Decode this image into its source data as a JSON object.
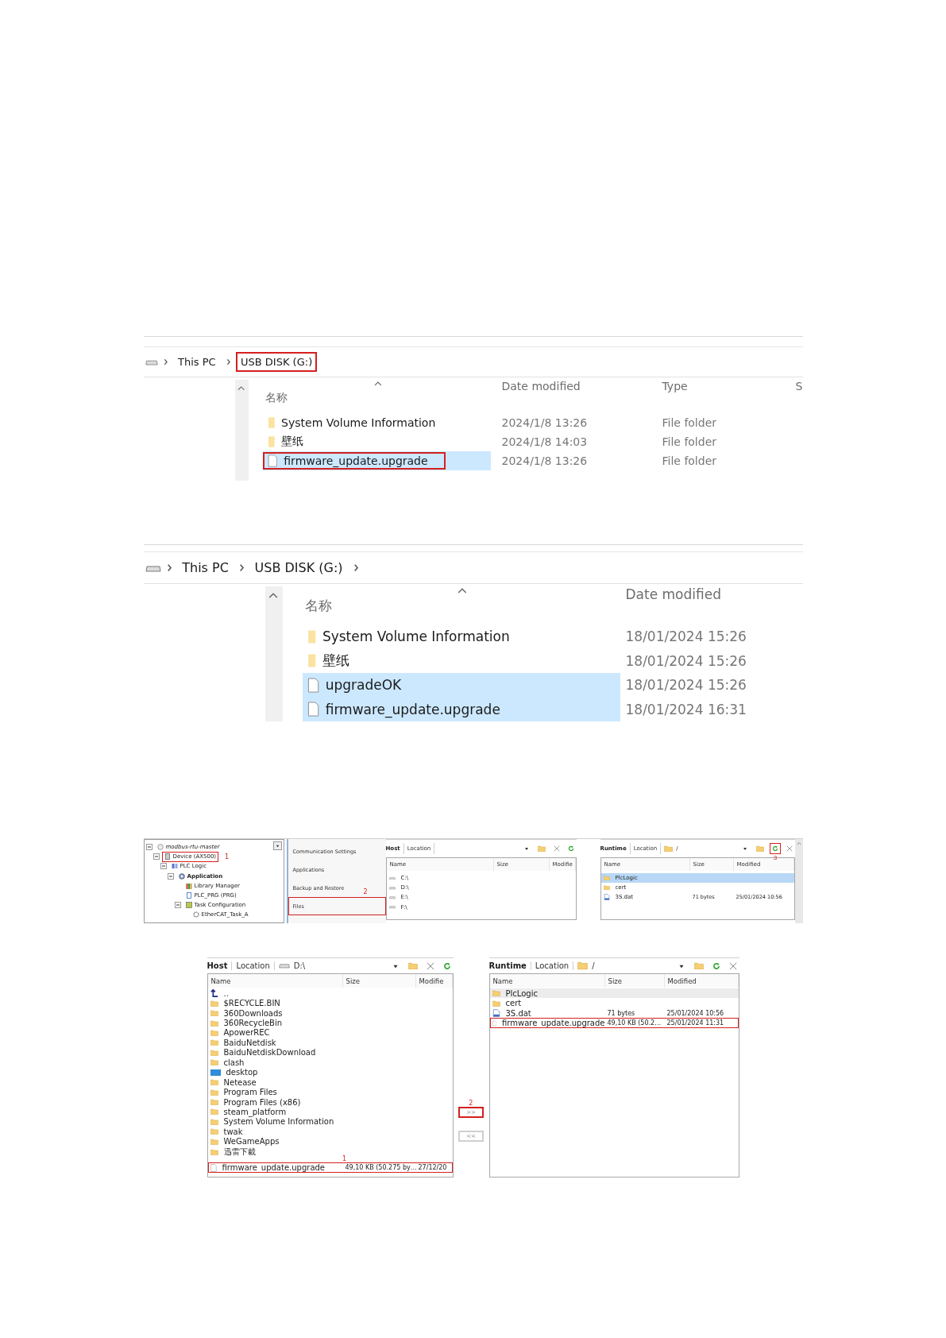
{
  "explorer_views": [
    {
      "kind": "compact",
      "crumbs": [
        {
          "label": "This PC",
          "highlighted": false
        },
        {
          "label": "USB DISK (G:)",
          "highlighted": true
        }
      ],
      "trailing_chevron": false,
      "columns": [
        "名称",
        "Date modified",
        "Type",
        "S"
      ],
      "rows": [
        {
          "kind": "folder",
          "cells": [
            "System Volume Information",
            "2024/1/8 13:26",
            "File folder"
          ],
          "selected": false,
          "highlighted": false
        },
        {
          "kind": "folder",
          "cells": [
            "壁纸",
            "2024/1/8 14:03",
            "File folder"
          ],
          "selected": false,
          "highlighted": false
        },
        {
          "kind": "file",
          "cells": [
            "firmware_update.upgrade",
            "2024/1/8 13:26",
            "File folder"
          ],
          "selected": true,
          "highlighted": true
        }
      ]
    },
    {
      "kind": "large",
      "crumbs": [
        {
          "label": "This PC",
          "highlighted": false
        },
        {
          "label": "USB DISK (G:)",
          "highlighted": false
        }
      ],
      "trailing_chevron": true,
      "columns": [
        "名称",
        "Date modified"
      ],
      "rows": [
        {
          "kind": "folder",
          "cells": [
            "System Volume Information",
            "18/01/2024 15:26"
          ],
          "selected": false,
          "highlighted": false
        },
        {
          "kind": "folder",
          "cells": [
            "壁纸",
            "18/01/2024 15:26"
          ],
          "selected": false,
          "highlighted": false
        },
        {
          "kind": "file",
          "cells": [
            "upgradeOK",
            "18/01/2024 15:26"
          ],
          "selected": true,
          "highlighted": false
        },
        {
          "kind": "file",
          "cells": [
            "firmware_update.upgrade",
            "18/01/2024 16:31"
          ],
          "selected": true,
          "highlighted": false
        }
      ]
    }
  ],
  "device_view": {
    "tree": [
      {
        "kind": "project",
        "label": "modbus-rtu-master",
        "expanded": true,
        "highlighted": false,
        "children": [
          {
            "kind": "device",
            "label": "Device (AX500)",
            "expanded": true,
            "highlighted": true,
            "callout": "1",
            "children": [
              {
                "kind": "plc_logic",
                "label": "PLC Logic",
                "expanded": true,
                "highlighted": false,
                "children": [
                  {
                    "kind": "application",
                    "label": "Application",
                    "expanded": true,
                    "highlighted": false,
                    "children": [
                      {
                        "kind": "library",
                        "label": "Library Manager",
                        "highlighted": false
                      },
                      {
                        "kind": "pou",
                        "label": "PLC_PRG (PRG)",
                        "highlighted": false
                      },
                      {
                        "kind": "task_config",
                        "label": "Task Configuration",
                        "expanded": true,
                        "highlighted": false,
                        "children": [
                          {
                            "kind": "task",
                            "label": "EtherCAT_Task_A",
                            "highlighted": false
                          }
                        ]
                      }
                    ]
                  }
                ]
              }
            ]
          }
        ]
      }
    ],
    "nav": [
      {
        "label": "Communication Settings",
        "highlighted": false
      },
      {
        "label": "Applications",
        "highlighted": false
      },
      {
        "label": "Backup and Restore",
        "highlighted": false
      },
      {
        "label": "Files",
        "highlighted": true,
        "callout": "2"
      }
    ],
    "panels": [
      {
        "title": "Host",
        "location_label": "Location",
        "tools": [
          {
            "kind": "dropdown",
            "highlighted": false
          },
          {
            "kind": "new_folder",
            "highlighted": false
          },
          {
            "kind": "delete",
            "highlighted": false
          },
          {
            "kind": "refresh",
            "highlighted": false
          }
        ],
        "columns": [
          "Name",
          "Size",
          "Modifie"
        ],
        "rows": [
          {
            "kind": "drive",
            "cells": [
              "C:\\"
            ],
            "selected": false,
            "highlighted": false
          },
          {
            "kind": "drive",
            "cells": [
              "D:\\"
            ],
            "selected": false,
            "highlighted": false
          },
          {
            "kind": "drive",
            "cells": [
              "E:\\"
            ],
            "selected": false,
            "highlighted": false
          },
          {
            "kind": "drive",
            "cells": [
              "F:\\"
            ],
            "selected": false,
            "highlighted": false
          }
        ]
      },
      {
        "title": "Runtime",
        "location_label": "Location",
        "path": {
          "kind": "folder",
          "text": "/"
        },
        "focused": true,
        "tools": [
          {
            "kind": "dropdown",
            "highlighted": false
          },
          {
            "kind": "new_folder",
            "highlighted": false
          },
          {
            "kind": "refresh",
            "highlighted": true,
            "callout": "3"
          },
          {
            "kind": "delete",
            "highlighted": false
          }
        ],
        "columns": [
          "Name",
          "Size",
          "Modified"
        ],
        "rows": [
          {
            "kind": "folder",
            "cells": [
              "PlcLogic"
            ],
            "selected": true,
            "highlighted": false
          },
          {
            "kind": "folder",
            "cells": [
              "cert"
            ],
            "selected": false,
            "highlighted": false
          },
          {
            "kind": "dat",
            "cells": [
              "3S.dat",
              "71 bytes",
              "25/01/2024 10:56"
            ],
            "selected": false,
            "highlighted": false
          }
        ]
      }
    ]
  },
  "transfer_view": {
    "panels": [
      {
        "title": "Host",
        "location_label": "Location",
        "path": {
          "kind": "drive",
          "text": "D:\\"
        },
        "tools": [
          {
            "kind": "dropdown",
            "highlighted": false
          },
          {
            "kind": "new_folder",
            "highlighted": false
          },
          {
            "kind": "delete",
            "highlighted": false
          },
          {
            "kind": "refresh",
            "highlighted": false
          }
        ],
        "columns": [
          "Name",
          "Size",
          "Modifie"
        ],
        "rows": [
          {
            "kind": "up",
            "cells": [
              ".."
            ],
            "selected": false,
            "highlighted": false
          },
          {
            "kind": "folder",
            "cells": [
              "$RECYCLE.BIN"
            ],
            "selected": false,
            "highlighted": false
          },
          {
            "kind": "folder",
            "cells": [
              "360Downloads"
            ],
            "selected": false,
            "highlighted": false
          },
          {
            "kind": "folder",
            "cells": [
              "360RecycleBin"
            ],
            "selected": false,
            "highlighted": false
          },
          {
            "kind": "folder",
            "cells": [
              "ApowerREC"
            ],
            "selected": false,
            "highlighted": false
          },
          {
            "kind": "folder",
            "cells": [
              "BaiduNetdisk"
            ],
            "selected": false,
            "highlighted": false
          },
          {
            "kind": "folder",
            "cells": [
              "BaiduNetdiskDownload"
            ],
            "selected": false,
            "highlighted": false
          },
          {
            "kind": "folder",
            "cells": [
              "clash"
            ],
            "selected": false,
            "highlighted": false
          },
          {
            "kind": "desktop",
            "cells": [
              "desktop"
            ],
            "selected": false,
            "highlighted": false
          },
          {
            "kind": "folder",
            "cells": [
              "Netease"
            ],
            "selected": false,
            "highlighted": false
          },
          {
            "kind": "folder",
            "cells": [
              "Program Files"
            ],
            "selected": false,
            "highlighted": false
          },
          {
            "kind": "folder",
            "cells": [
              "Program Files (x86)"
            ],
            "selected": false,
            "highlighted": false
          },
          {
            "kind": "folder",
            "cells": [
              "steam_platform"
            ],
            "selected": false,
            "highlighted": false
          },
          {
            "kind": "folder",
            "cells": [
              "System Volume Information"
            ],
            "selected": false,
            "highlighted": false
          },
          {
            "kind": "folder",
            "cells": [
              "twak"
            ],
            "selected": false,
            "highlighted": false
          },
          {
            "kind": "folder",
            "cells": [
              "WeGameApps"
            ],
            "selected": false,
            "highlighted": false
          },
          {
            "kind": "folder",
            "cells": [
              "迅雷下載"
            ],
            "selected": false,
            "highlighted": false
          },
          {
            "kind": "file",
            "cells": [
              "firmware_update.upgrade",
              "49,10 KB (50.275 by…",
              "27/12/20"
            ],
            "selected": false,
            "highlighted": true,
            "callout": "1"
          }
        ]
      },
      {
        "title": "Runtime",
        "location_label": "Location",
        "path": {
          "kind": "folder",
          "text": "/"
        },
        "focused": false,
        "tools": [
          {
            "kind": "dropdown",
            "highlighted": false
          },
          {
            "kind": "new_folder",
            "highlighted": false
          },
          {
            "kind": "refresh",
            "highlighted": false
          },
          {
            "kind": "delete",
            "highlighted": false
          }
        ],
        "columns": [
          "Name",
          "Size",
          "Modified"
        ],
        "rows": [
          {
            "kind": "folder",
            "cells": [
              "PlcLogic"
            ],
            "selected": true,
            "highlighted": false
          },
          {
            "kind": "folder",
            "cells": [
              "cert"
            ],
            "selected": false,
            "highlighted": false
          },
          {
            "kind": "dat",
            "cells": [
              "3S.dat",
              "71 bytes",
              "25/01/2024 10:56"
            ],
            "selected": false,
            "highlighted": false
          },
          {
            "kind": "file",
            "cells": [
              "firmware_update.upgrade",
              "49,10 KB (50.2…",
              "25/01/2024 11:31"
            ],
            "selected": false,
            "highlighted": true
          }
        ]
      }
    ],
    "buttons": [
      {
        "label": ">>",
        "highlighted": true,
        "callout": "2"
      },
      {
        "label": "<<",
        "highlighted": false
      }
    ]
  }
}
